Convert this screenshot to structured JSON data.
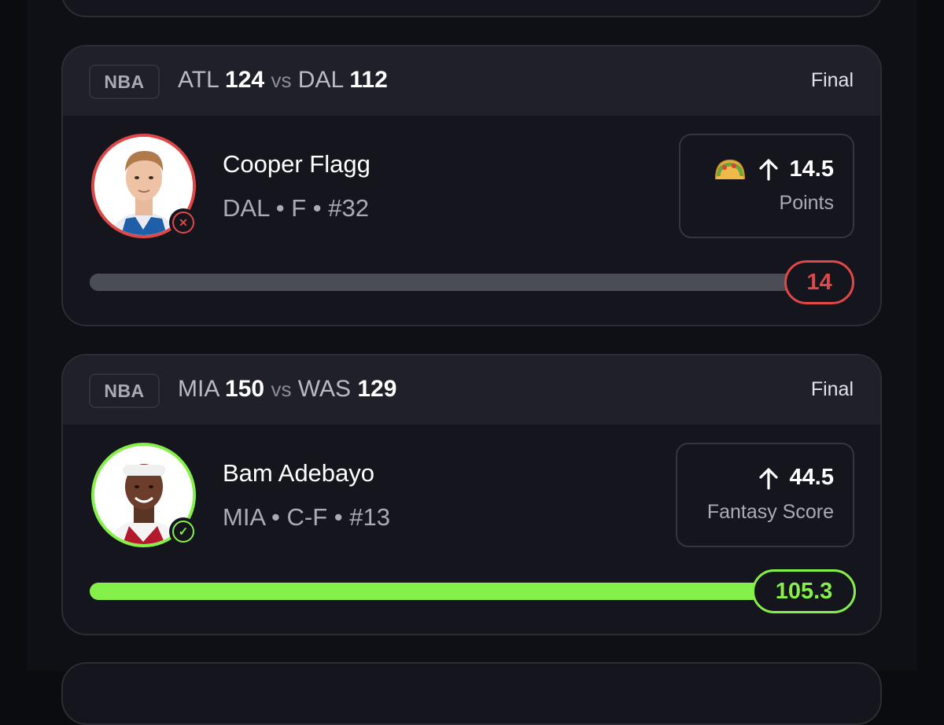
{
  "colors": {
    "background": "#0f1016",
    "card": "#15161d",
    "header": "#1f2029",
    "loss_red": "#e04848",
    "win_green": "#86f04a",
    "track_gray": "#4a4c56"
  },
  "picks": [
    {
      "league": "NBA",
      "home_team": "ATL",
      "home_score": "124",
      "vs": "vs",
      "away_team": "DAL",
      "away_score": "112",
      "status": "Final",
      "player_name": "Cooper Flagg",
      "player_meta": "DAL • F • #32",
      "result": "loss",
      "result_icon": "x-icon",
      "promo_icon": "taco-icon",
      "direction_icon": "arrow-up-icon",
      "line_value": "14.5",
      "stat_label": "Points",
      "actual_value": "14",
      "progress_fraction": 1.0
    },
    {
      "league": "NBA",
      "home_team": "MIA",
      "home_score": "150",
      "vs": "vs",
      "away_team": "WAS",
      "away_score": "129",
      "status": "Final",
      "player_name": "Bam Adebayo",
      "player_meta": "MIA • C-F • #13",
      "result": "win",
      "result_icon": "check-icon",
      "direction_icon": "arrow-up-icon",
      "line_value": "44.5",
      "stat_label": "Fantasy Score",
      "actual_value": "105.3",
      "progress_fraction": 1.0
    }
  ]
}
